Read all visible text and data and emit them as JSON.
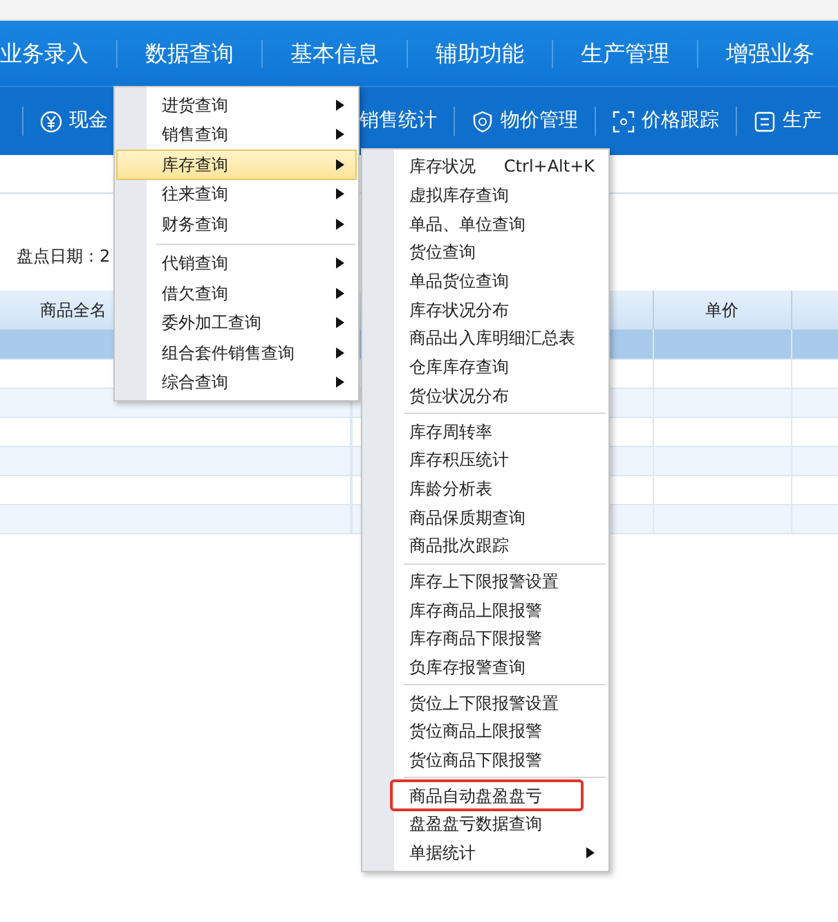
{
  "nav": {
    "items": [
      {
        "label": "业务录入"
      },
      {
        "label": "数据查询"
      },
      {
        "label": "基本信息"
      },
      {
        "label": "辅助功能"
      },
      {
        "label": "生产管理"
      },
      {
        "label": "增强业务"
      }
    ]
  },
  "toolbar": {
    "items": [
      {
        "label": "现金"
      },
      {
        "label": "销售统计"
      },
      {
        "label": "物价管理"
      },
      {
        "label": "价格跟踪"
      },
      {
        "label": "生产"
      }
    ]
  },
  "form": {
    "label": "盘点日期：",
    "value": "2"
  },
  "table": {
    "columns": [
      {
        "label": "商品全名"
      },
      {
        "label": "单价"
      }
    ],
    "rows": [
      {
        "selected": true
      },
      {
        "selected": false
      },
      {
        "selected": false
      },
      {
        "selected": false
      },
      {
        "selected": false
      },
      {
        "selected": false
      },
      {
        "selected": false
      }
    ]
  },
  "menu": {
    "items": [
      {
        "kind": "item",
        "label": "进货查询",
        "has_submenu": true,
        "selected": false
      },
      {
        "kind": "item",
        "label": "销售查询",
        "has_submenu": true,
        "selected": false
      },
      {
        "kind": "item",
        "label": "库存查询",
        "has_submenu": true,
        "selected": true
      },
      {
        "kind": "item",
        "label": "往来查询",
        "has_submenu": true,
        "selected": false
      },
      {
        "kind": "item",
        "label": "财务查询",
        "has_submenu": true,
        "selected": false
      },
      {
        "kind": "separator"
      },
      {
        "kind": "item",
        "label": "代销查询",
        "has_submenu": true,
        "selected": false
      },
      {
        "kind": "item",
        "label": "借欠查询",
        "has_submenu": true,
        "selected": false
      },
      {
        "kind": "item",
        "label": "委外加工查询",
        "has_submenu": true,
        "selected": false
      },
      {
        "kind": "item",
        "label": "组合套件销售查询",
        "has_submenu": true,
        "selected": false
      },
      {
        "kind": "item",
        "label": "综合查询",
        "has_submenu": true,
        "selected": false
      }
    ]
  },
  "submenu": {
    "items": [
      {
        "kind": "item",
        "label": "库存状况",
        "shortcut": "Ctrl+Alt+K"
      },
      {
        "kind": "item",
        "label": "虚拟库存查询"
      },
      {
        "kind": "item",
        "label": "单品、单位查询"
      },
      {
        "kind": "item",
        "label": "货位查询"
      },
      {
        "kind": "item",
        "label": "单品货位查询"
      },
      {
        "kind": "item",
        "label": "库存状况分布"
      },
      {
        "kind": "item",
        "label": "商品出入库明细汇总表"
      },
      {
        "kind": "item",
        "label": "仓库库存查询"
      },
      {
        "kind": "item",
        "label": "货位状况分布"
      },
      {
        "kind": "separator"
      },
      {
        "kind": "item",
        "label": "库存周转率"
      },
      {
        "kind": "item",
        "label": "库存积压统计"
      },
      {
        "kind": "item",
        "label": "库龄分析表"
      },
      {
        "kind": "item",
        "label": "商品保质期查询"
      },
      {
        "kind": "item",
        "label": "商品批次跟踪"
      },
      {
        "kind": "separator"
      },
      {
        "kind": "item",
        "label": "库存上下限报警设置"
      },
      {
        "kind": "item",
        "label": "库存商品上限报警"
      },
      {
        "kind": "item",
        "label": "库存商品下限报警"
      },
      {
        "kind": "item",
        "label": "负库存报警查询"
      },
      {
        "kind": "separator"
      },
      {
        "kind": "item",
        "label": "货位上下限报警设置"
      },
      {
        "kind": "item",
        "label": "货位商品上限报警"
      },
      {
        "kind": "item",
        "label": "货位商品下限报警"
      },
      {
        "kind": "separator"
      },
      {
        "kind": "item",
        "label": "商品自动盘盈盘亏",
        "outlined": true
      },
      {
        "kind": "item",
        "label": "盘盈盘亏数据查询"
      },
      {
        "kind": "item",
        "label": "单据统计",
        "has_submenu": true
      }
    ]
  }
}
